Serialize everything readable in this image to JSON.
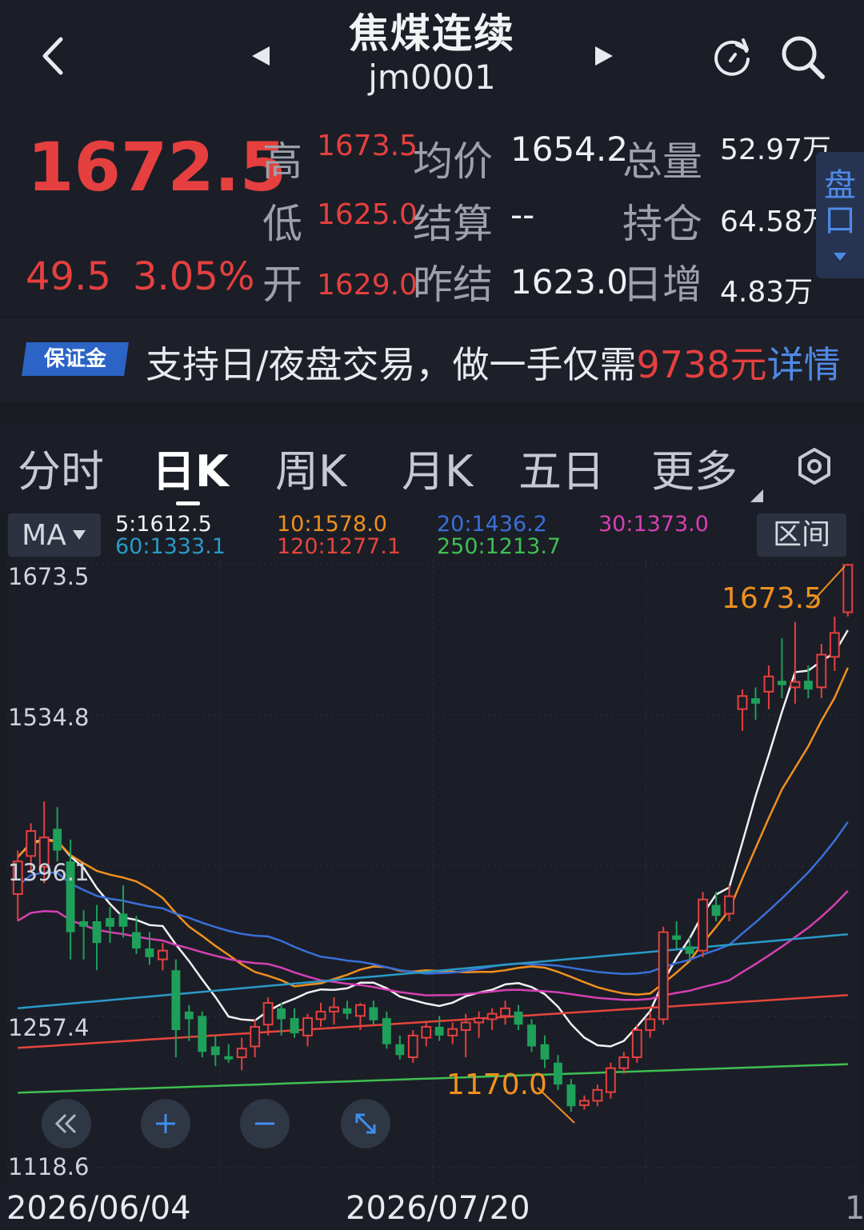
{
  "header": {
    "title": "焦煤连续",
    "code": "jm0001",
    "icons": [
      "back-arrow-icon",
      "prev-triangle-icon",
      "next-triangle-icon",
      "refresh-icon",
      "search-icon"
    ]
  },
  "quote": {
    "price": "1672.5",
    "change": "49.5",
    "change_pct": "3.05%",
    "high_label": "高",
    "high": "1673.5",
    "low_label": "低",
    "low": "1625.0",
    "open_label": "开",
    "open": "1629.0",
    "avg_label": "均价",
    "avg": "1654.2",
    "settle_label": "结算",
    "settle": "--",
    "prev_settle_label": "昨结",
    "prev_settle": "1623.0",
    "volume_label": "总量",
    "volume": "52.97万",
    "oi_label": "持仓",
    "oi": "64.58万",
    "daily_inc_label": "日增",
    "daily_inc": "4.83万",
    "pankou_1": "盘",
    "pankou_2": "口",
    "colors": {
      "up": "#e5403f",
      "down": "#1fa05a",
      "accent": "#4f8ae8"
    }
  },
  "banner": {
    "badge": "保证金",
    "text_prefix": "支持日/夜盘交易，做一手仅需",
    "amount": "9738元",
    "text_suffix": "详情"
  },
  "tabs": [
    "分时",
    "日K",
    "周K",
    "月K",
    "五日",
    "更多"
  ],
  "active_tab": "日K",
  "chart": {
    "indicator": "MA",
    "range_button": "区间",
    "legend": [
      {
        "label": "5:1612.5",
        "color": "#f2f2f2"
      },
      {
        "label": "10:1578.0",
        "color": "#f0901f"
      },
      {
        "label": "20:1436.2",
        "color": "#3a6fd9"
      },
      {
        "label": "30:1373.0",
        "color": "#d640b4"
      },
      {
        "label": "60:1333.1",
        "color": "#2a9ac7"
      },
      {
        "label": "120:1277.1",
        "color": "#e6453b"
      },
      {
        "label": "250:1213.7",
        "color": "#3fbf52"
      }
    ],
    "y_labels": [
      "1673.5",
      "1534.8",
      "1396.1",
      "1257.4",
      "1118.6"
    ],
    "x_labels": [
      "2026/06/04",
      "2026/07/20"
    ],
    "max_annotation": "1673.5",
    "min_annotation": "1170.0",
    "page_marker": "1",
    "controls": [
      "rewind-icon",
      "zoom-in-icon",
      "zoom-out-icon",
      "fullscreen-icon"
    ]
  },
  "chart_data": {
    "type": "candlestick",
    "y_axis": {
      "min": 1118.6,
      "max": 1673.5,
      "ticks": [
        1673.5,
        1534.8,
        1396.1,
        1257.4,
        1118.6
      ]
    },
    "x_axis": {
      "ticks": [
        "2026/06/04",
        "2026/07/20"
      ]
    },
    "candles": [
      {
        "o": 1370,
        "h": 1410,
        "l": 1345,
        "c": 1400
      },
      {
        "o": 1405,
        "h": 1435,
        "l": 1390,
        "c": 1428
      },
      {
        "o": 1395,
        "h": 1455,
        "l": 1380,
        "c": 1422
      },
      {
        "o": 1430,
        "h": 1450,
        "l": 1400,
        "c": 1410
      },
      {
        "o": 1400,
        "h": 1420,
        "l": 1310,
        "c": 1335
      },
      {
        "o": 1345,
        "h": 1355,
        "l": 1310,
        "c": 1340
      },
      {
        "o": 1345,
        "h": 1360,
        "l": 1300,
        "c": 1325
      },
      {
        "o": 1348,
        "h": 1358,
        "l": 1325,
        "c": 1340
      },
      {
        "o": 1352,
        "h": 1378,
        "l": 1330,
        "c": 1340
      },
      {
        "o": 1335,
        "h": 1350,
        "l": 1315,
        "c": 1320
      },
      {
        "o": 1320,
        "h": 1335,
        "l": 1305,
        "c": 1312
      },
      {
        "o": 1310,
        "h": 1325,
        "l": 1300,
        "c": 1318
      },
      {
        "o": 1300,
        "h": 1310,
        "l": 1220,
        "c": 1245
      },
      {
        "o": 1262,
        "h": 1268,
        "l": 1235,
        "c": 1255
      },
      {
        "o": 1258,
        "h": 1262,
        "l": 1220,
        "c": 1225
      },
      {
        "o": 1230,
        "h": 1240,
        "l": 1212,
        "c": 1222
      },
      {
        "o": 1221,
        "h": 1232,
        "l": 1215,
        "c": 1218
      },
      {
        "o": 1220,
        "h": 1238,
        "l": 1208,
        "c": 1228
      },
      {
        "o": 1230,
        "h": 1255,
        "l": 1220,
        "c": 1248
      },
      {
        "o": 1250,
        "h": 1275,
        "l": 1240,
        "c": 1270
      },
      {
        "o": 1265,
        "h": 1270,
        "l": 1240,
        "c": 1255
      },
      {
        "o": 1256,
        "h": 1265,
        "l": 1238,
        "c": 1242
      },
      {
        "o": 1240,
        "h": 1260,
        "l": 1230,
        "c": 1256
      },
      {
        "o": 1255,
        "h": 1270,
        "l": 1248,
        "c": 1262
      },
      {
        "o": 1262,
        "h": 1275,
        "l": 1250,
        "c": 1266
      },
      {
        "o": 1265,
        "h": 1272,
        "l": 1255,
        "c": 1260
      },
      {
        "o": 1258,
        "h": 1270,
        "l": 1245,
        "c": 1268
      },
      {
        "o": 1266,
        "h": 1272,
        "l": 1250,
        "c": 1254
      },
      {
        "o": 1256,
        "h": 1262,
        "l": 1228,
        "c": 1232
      },
      {
        "o": 1232,
        "h": 1240,
        "l": 1218,
        "c": 1222
      },
      {
        "o": 1220,
        "h": 1245,
        "l": 1215,
        "c": 1240
      },
      {
        "o": 1238,
        "h": 1252,
        "l": 1230,
        "c": 1248
      },
      {
        "o": 1248,
        "h": 1258,
        "l": 1235,
        "c": 1240
      },
      {
        "o": 1240,
        "h": 1252,
        "l": 1232,
        "c": 1246
      },
      {
        "o": 1245,
        "h": 1260,
        "l": 1220,
        "c": 1252
      },
      {
        "o": 1252,
        "h": 1262,
        "l": 1238,
        "c": 1256
      },
      {
        "o": 1255,
        "h": 1265,
        "l": 1245,
        "c": 1260
      },
      {
        "o": 1258,
        "h": 1272,
        "l": 1250,
        "c": 1265
      },
      {
        "o": 1262,
        "h": 1268,
        "l": 1245,
        "c": 1250
      },
      {
        "o": 1250,
        "h": 1255,
        "l": 1225,
        "c": 1230
      },
      {
        "o": 1232,
        "h": 1240,
        "l": 1210,
        "c": 1218
      },
      {
        "o": 1215,
        "h": 1222,
        "l": 1190,
        "c": 1195
      },
      {
        "o": 1195,
        "h": 1200,
        "l": 1170,
        "c": 1175
      },
      {
        "o": 1176,
        "h": 1185,
        "l": 1172,
        "c": 1180
      },
      {
        "o": 1180,
        "h": 1195,
        "l": 1175,
        "c": 1190
      },
      {
        "o": 1188,
        "h": 1215,
        "l": 1182,
        "c": 1210
      },
      {
        "o": 1210,
        "h": 1225,
        "l": 1205,
        "c": 1220
      },
      {
        "o": 1220,
        "h": 1250,
        "l": 1215,
        "c": 1245
      },
      {
        "o": 1245,
        "h": 1262,
        "l": 1238,
        "c": 1255
      },
      {
        "o": 1255,
        "h": 1340,
        "l": 1250,
        "c": 1335
      },
      {
        "o": 1332,
        "h": 1345,
        "l": 1320,
        "c": 1328
      },
      {
        "o": 1322,
        "h": 1330,
        "l": 1310,
        "c": 1315
      },
      {
        "o": 1318,
        "h": 1372,
        "l": 1312,
        "c": 1365
      },
      {
        "o": 1360,
        "h": 1372,
        "l": 1345,
        "c": 1350
      },
      {
        "o": 1352,
        "h": 1378,
        "l": 1345,
        "c": 1368
      },
      {
        "o": 1540,
        "h": 1558,
        "l": 1520,
        "c": 1552
      },
      {
        "o": 1550,
        "h": 1560,
        "l": 1530,
        "c": 1545
      },
      {
        "o": 1556,
        "h": 1580,
        "l": 1540,
        "c": 1570
      },
      {
        "o": 1566,
        "h": 1605,
        "l": 1550,
        "c": 1562
      },
      {
        "o": 1560,
        "h": 1620,
        "l": 1545,
        "c": 1565
      },
      {
        "o": 1566,
        "h": 1580,
        "l": 1550,
        "c": 1558
      },
      {
        "o": 1560,
        "h": 1600,
        "l": 1550,
        "c": 1590
      },
      {
        "o": 1588,
        "h": 1625,
        "l": 1575,
        "c": 1610
      },
      {
        "o": 1629,
        "h": 1673.5,
        "l": 1625,
        "c": 1672.5
      }
    ],
    "moving_averages": [
      {
        "name": "MA5",
        "value": 1612.5
      },
      {
        "name": "MA10",
        "value": 1578.0
      },
      {
        "name": "MA20",
        "value": 1436.2
      },
      {
        "name": "MA30",
        "value": 1373.0
      },
      {
        "name": "MA60",
        "value": 1333.1
      },
      {
        "name": "MA120",
        "value": 1277.1
      },
      {
        "name": "MA250",
        "value": 1213.7
      }
    ],
    "annotations": [
      {
        "label": "1673.5",
        "type": "max"
      },
      {
        "label": "1170.0",
        "type": "min"
      }
    ]
  }
}
